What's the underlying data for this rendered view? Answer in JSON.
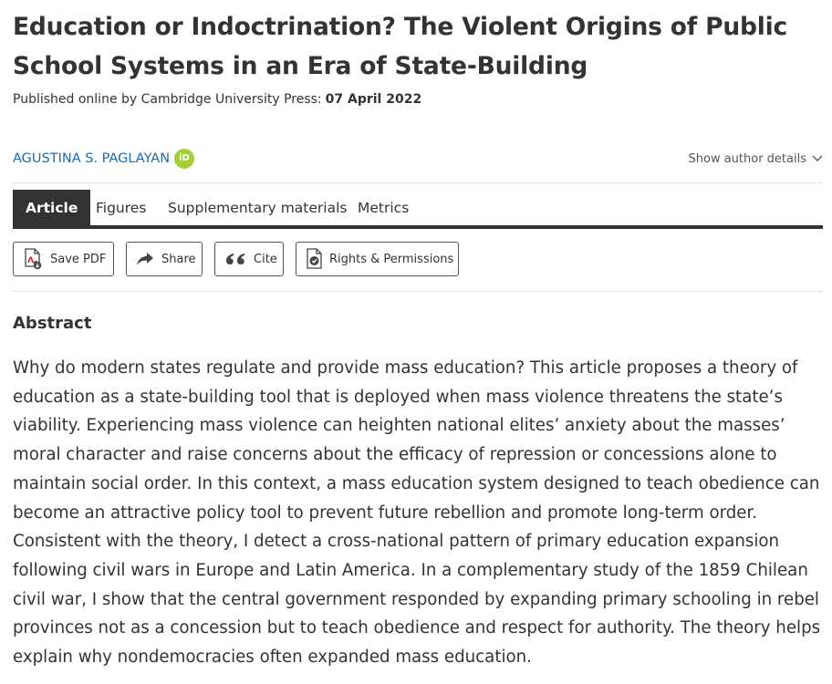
{
  "article": {
    "title": "Education or Indoctrination? The Violent Origins of Public School Systems in an Era of State-Building",
    "published_label": "Published online by Cambridge University Press:",
    "published_date": "07 April 2022"
  },
  "author": {
    "name": "AGUSTINA S. PAGLAYAN",
    "orcid_label": "iD",
    "show_details": "Show author details"
  },
  "tabs": [
    {
      "label": "Article",
      "active": true
    },
    {
      "label": "Figures",
      "active": false
    },
    {
      "label": "Supplementary materials",
      "active": false
    },
    {
      "label": "Metrics",
      "active": false
    }
  ],
  "toolbar": {
    "save_pdf": "Save PDF",
    "share": "Share",
    "cite": "Cite",
    "rights": "Rights & Permissions"
  },
  "abstract": {
    "heading": "Abstract",
    "body": "Why do modern states regulate and provide mass education? This article proposes a theory of education as a state-building tool that is deployed when mass violence threatens the state’s viability. Experiencing mass violence can heighten national elites’ anxiety about the masses’ moral character and raise concerns about the efficacy of repression or concessions alone to maintain social order. In this context, a mass education system designed to teach obedience can become an attractive policy tool to prevent future rebellion and promote long-term order. Consistent with the theory, I detect a cross-national pattern of primary education expansion following civil wars in Europe and Latin America. In a complementary study of the 1859 Chilean civil war, I show that the central government responded by expanding primary schooling in rebel provinces not as a concession but to teach obedience and respect for authority. The theory helps explain why nondemocracies often expanded mass education."
  },
  "colors": {
    "text": "#333333",
    "link": "#1f6aa8",
    "orcid": "#a6ce39",
    "tab_active_bg": "#333333"
  }
}
